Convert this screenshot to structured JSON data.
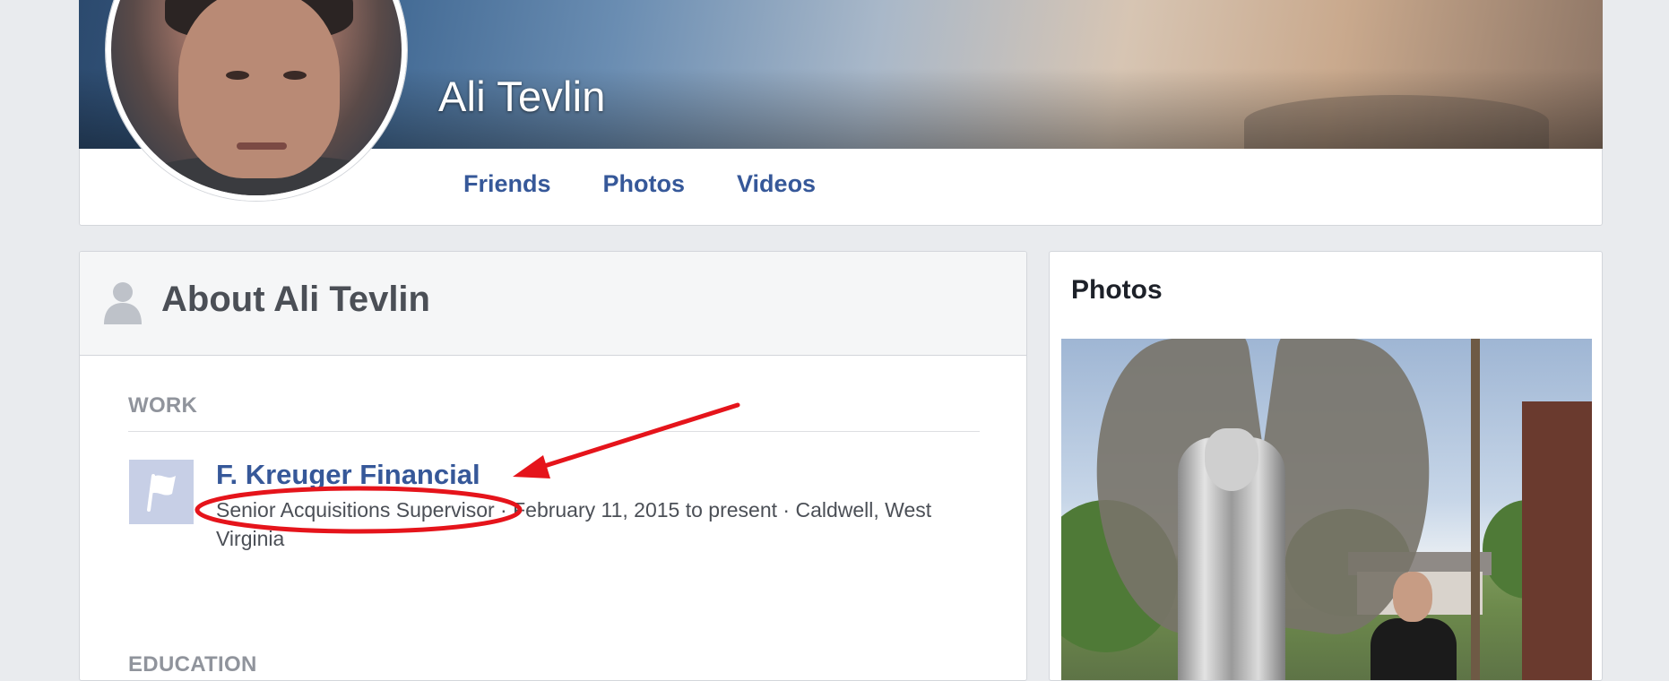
{
  "profile": {
    "name": "Ali Tevlin",
    "tabs": [
      "Friends",
      "Photos",
      "Videos"
    ]
  },
  "about": {
    "title": "About Ali Tevlin",
    "work_label": "WORK",
    "employer": "F. Kreuger Financial",
    "detail": "Senior Acquisitions Supervisor · February 11, 2015 to present · Caldwell, West Virginia",
    "education_label": "EDUCATION"
  },
  "photos": {
    "title": "Photos"
  },
  "colors": {
    "link": "#365899",
    "annotation": "#e5141b",
    "page_bg": "#e9ebee"
  },
  "icons": {
    "about": "person-silhouette-icon",
    "work": "flag-icon"
  }
}
